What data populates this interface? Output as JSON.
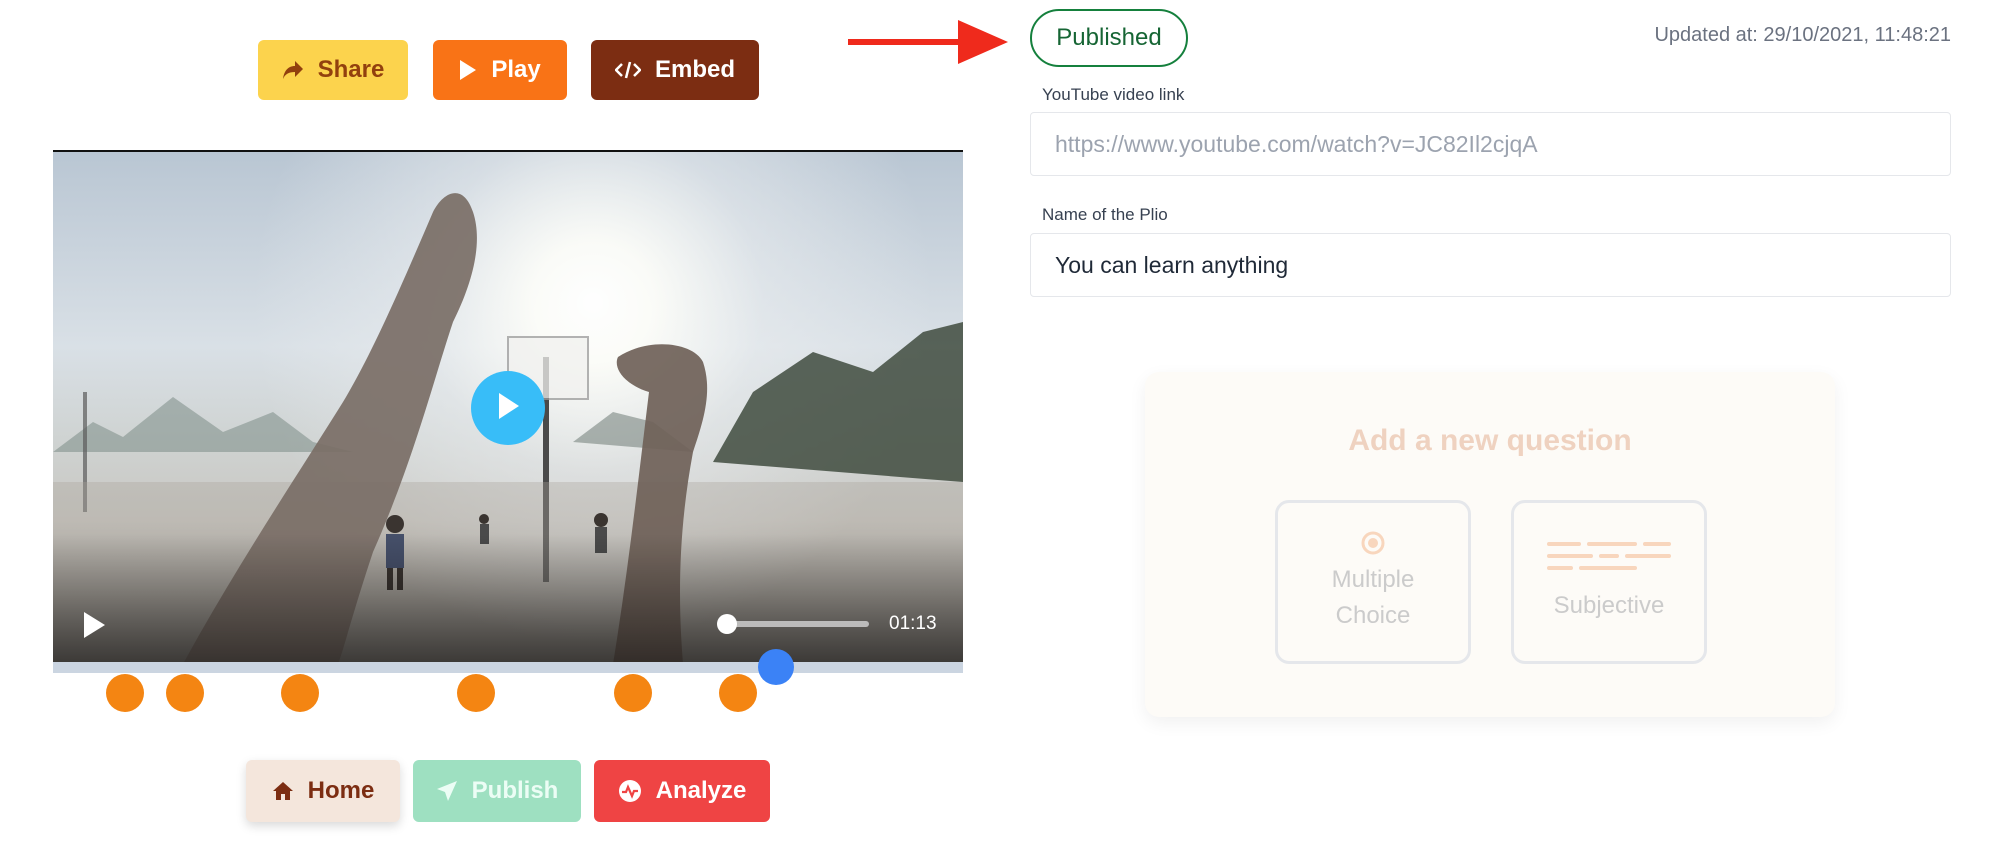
{
  "toolbar": {
    "share_label": "Share",
    "play_label": "Play",
    "embed_label": "Embed"
  },
  "video": {
    "time": "01:13"
  },
  "nav": {
    "home_label": "Home",
    "publish_label": "Publish",
    "analyze_label": "Analyze"
  },
  "status": {
    "badge": "Published",
    "updated": "Updated at: 29/10/2021, 11:48:21"
  },
  "form": {
    "youtube_label": "YouTube video link",
    "youtube_placeholder": "https://www.youtube.com/watch?v=JC82Il2cjqA",
    "name_label": "Name of the Plio",
    "name_value": "You can learn anything"
  },
  "question": {
    "title": "Add a new question",
    "multiple_choice": [
      "Multiple",
      "Choice"
    ],
    "subjective": "Subjective"
  },
  "colors": {
    "share": "#fcd34d",
    "play": "#f97316",
    "embed": "#7c2d12",
    "publish": "#9ee0c1",
    "analyze": "#ef4444",
    "marker": "#f48512",
    "playhead": "#3b82f6",
    "published_badge": "#15803d"
  },
  "icons": {
    "share": "share-arrow-icon",
    "play": "play-icon",
    "embed": "code-icon",
    "home": "home-icon",
    "publish": "send-icon",
    "analyze": "activity-icon"
  }
}
